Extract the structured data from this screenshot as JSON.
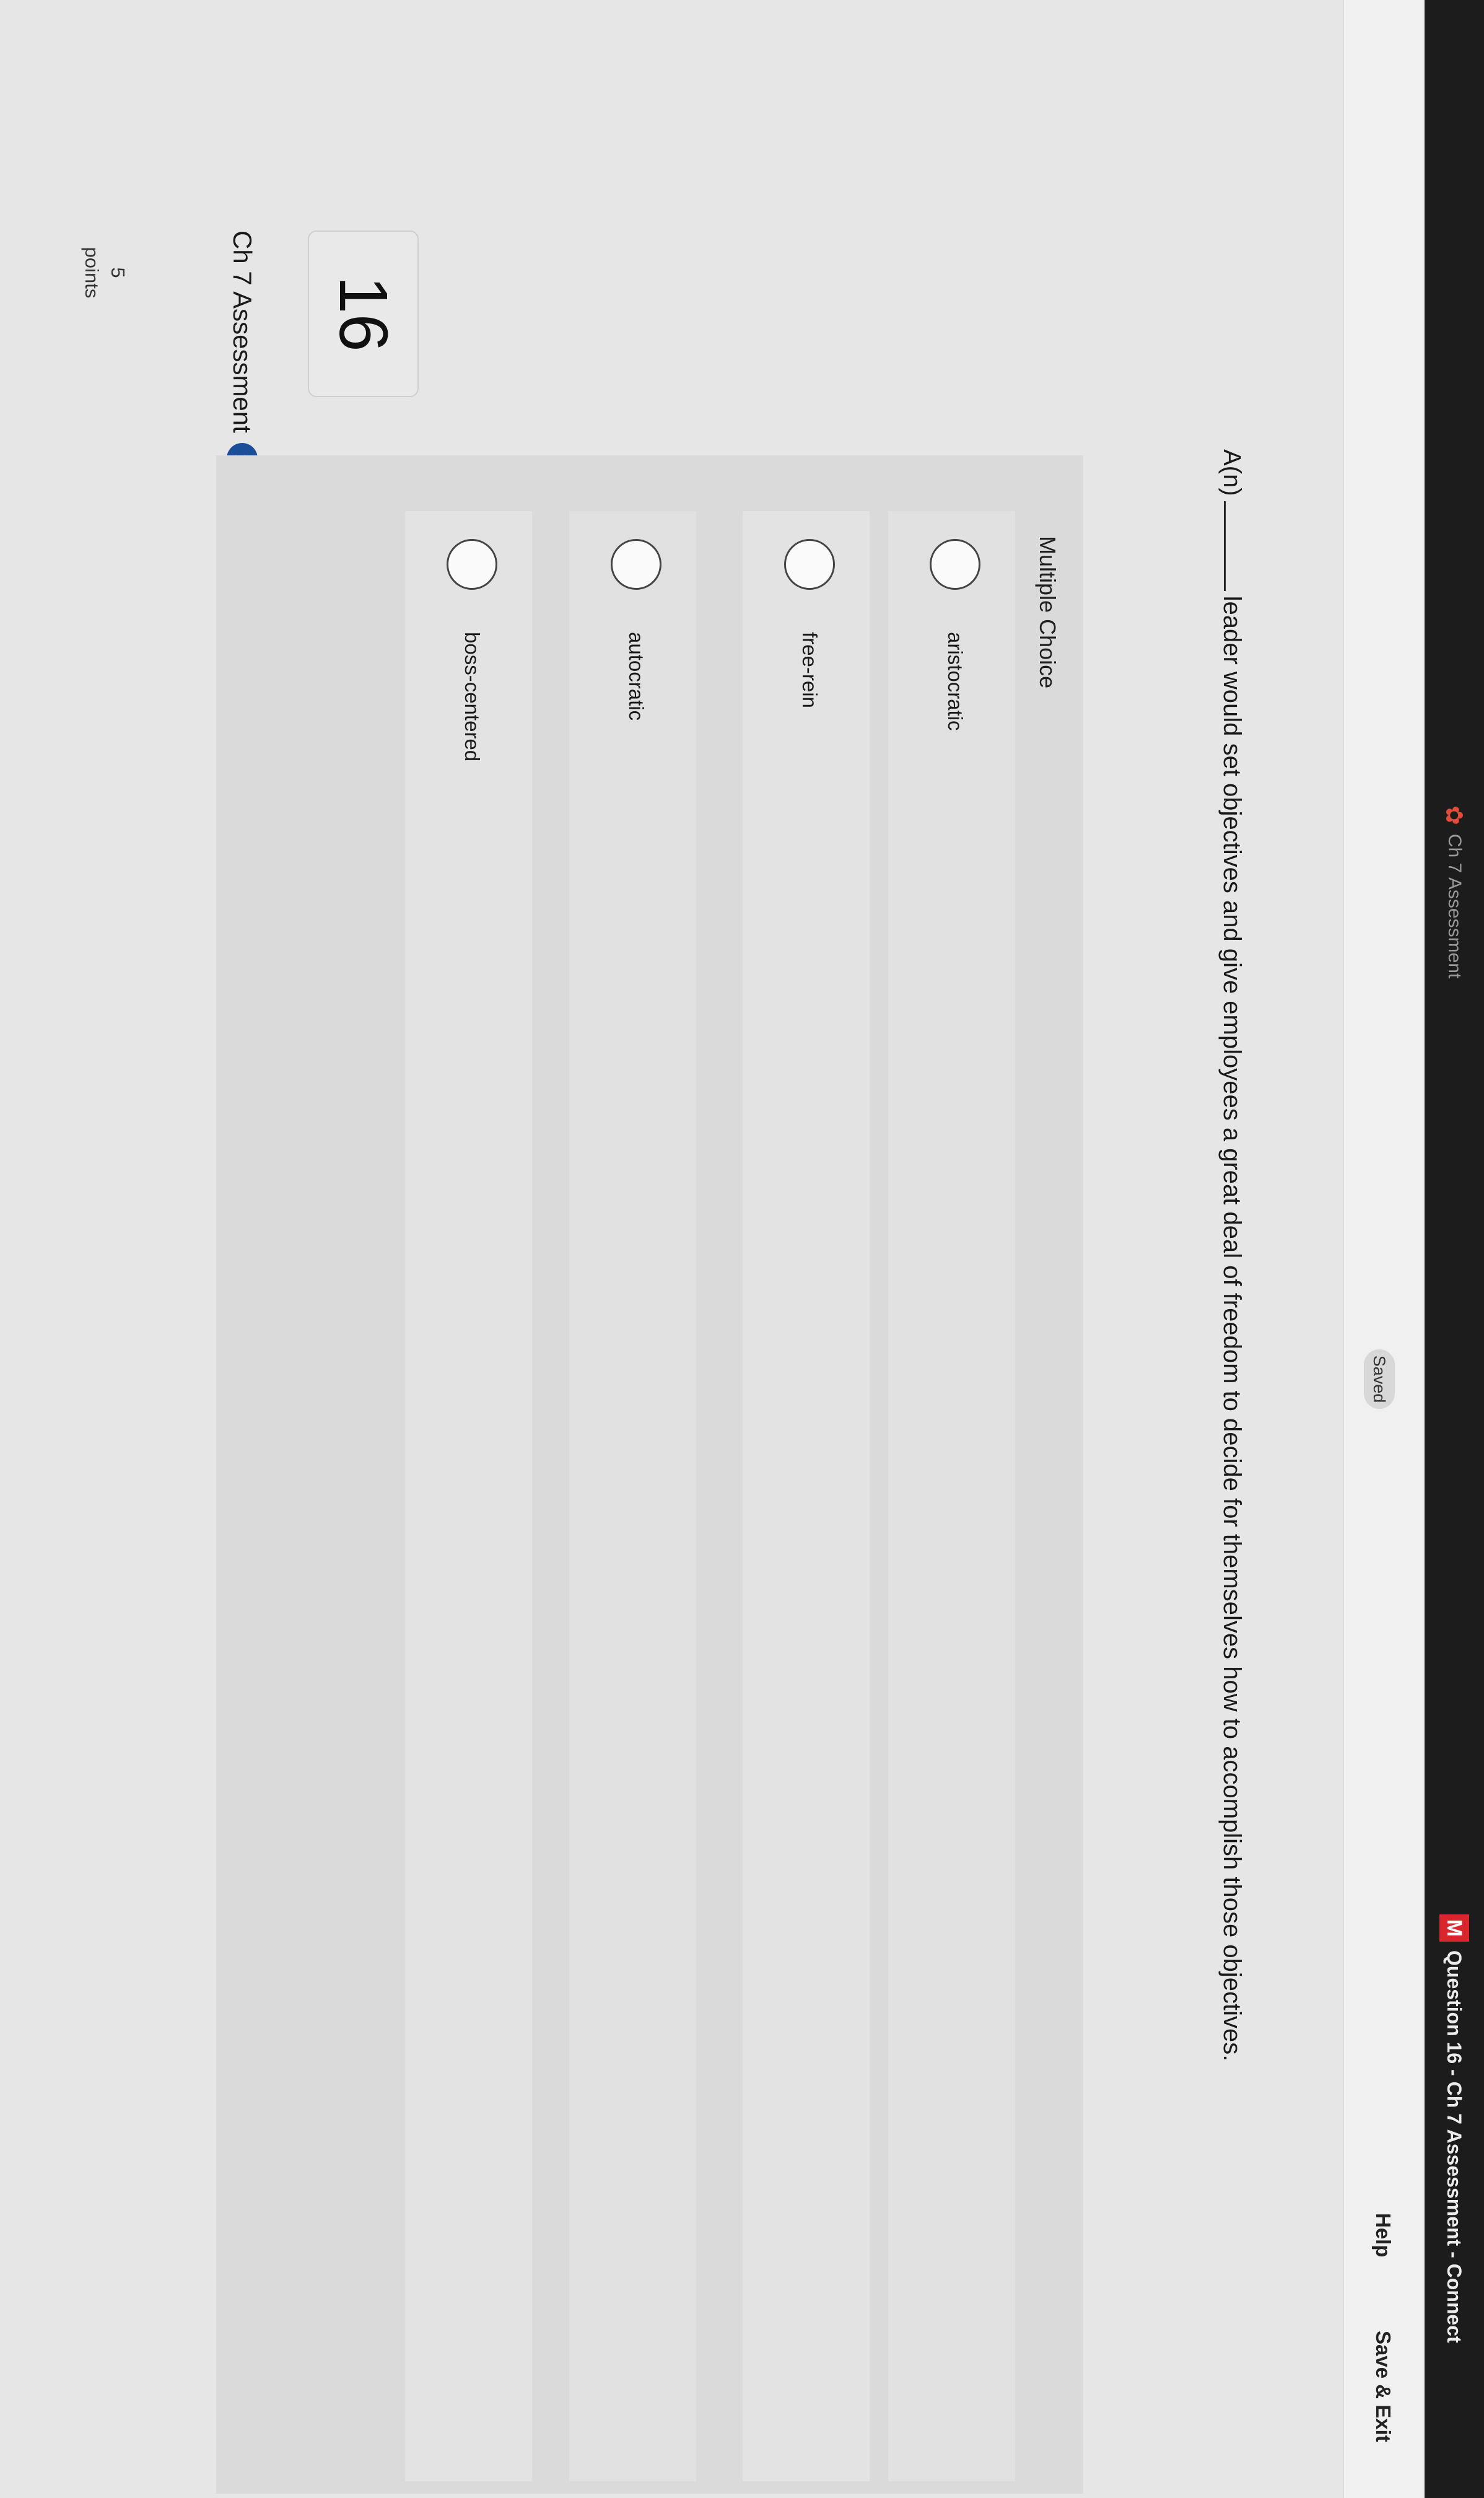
{
  "browser": {
    "tab_title": "Ch 7 Assessment",
    "window_title": "Question 16 - Ch 7 Assessment - Connect",
    "logo_letter": "M"
  },
  "header": {
    "status": "Saved",
    "help_label": "Help",
    "save_exit_label": "Save & Exit"
  },
  "assessment": {
    "title": "Ch 7 Assessment"
  },
  "question": {
    "number": "16",
    "points_value": "5",
    "points_label": "points",
    "prefix": "A(n)",
    "text": "leader would set objectives and give employees a great deal of freedom to decide for themselves how to accomplish those objectives.",
    "type_label": "Multiple Choice",
    "options": [
      {
        "label": "aristocratic"
      },
      {
        "label": "free-rein"
      },
      {
        "label": "autocratic"
      },
      {
        "label": "boss-centered"
      }
    ]
  }
}
